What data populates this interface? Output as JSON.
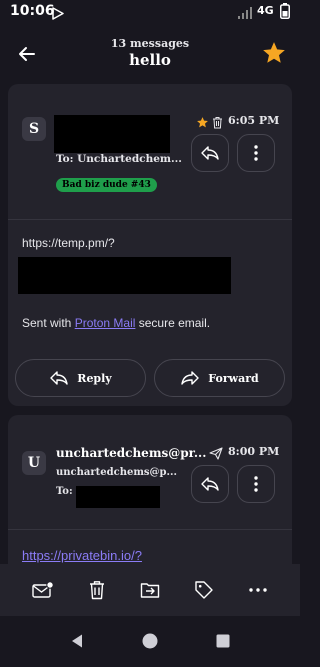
{
  "status_bar": {
    "time": "10:06",
    "network": "4G"
  },
  "header": {
    "message_count": "13 messages",
    "subject": "hello"
  },
  "message1": {
    "avatar": "S",
    "to_line": "To: Unchartedchem...",
    "label": "Bad biz dude #43",
    "time": "6:05 PM",
    "body_url": "https://temp.pm/?",
    "signature_prefix": "Sent with ",
    "signature_link": "Proton Mail",
    "signature_suffix": " secure email.",
    "reply_label": "Reply",
    "forward_label": "Forward"
  },
  "message2": {
    "avatar": "U",
    "sender": "unchartedchems@pr...",
    "sender_address": "unchartedchems@p...",
    "to_label": "To:",
    "time": "8:00 PM",
    "body_url": "https://privatebin.io/?"
  },
  "colors": {
    "accent": "#8b7cf6",
    "star": "#f5a623",
    "label_bg": "#1f9e4b"
  }
}
